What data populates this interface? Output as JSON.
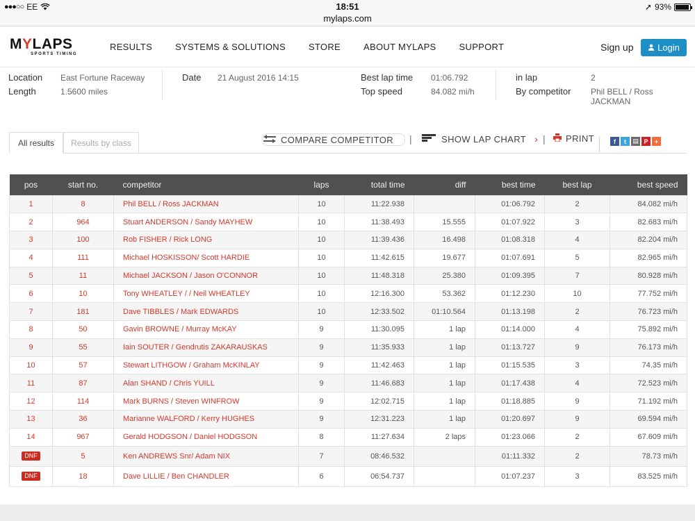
{
  "statusbar": {
    "carrier": "EE",
    "time": "18:51",
    "url": "mylaps.com",
    "battery": "93%"
  },
  "nav": {
    "logo_main_a": "M",
    "logo_main_b": "Y",
    "logo_main_c": "LAPS",
    "logo_sub": "SPORTS TIMING",
    "links": [
      "RESULTS",
      "SYSTEMS & SOLUTIONS",
      "STORE",
      "ABOUT MYLAPS",
      "SUPPORT"
    ],
    "signup": "Sign up",
    "login": "Login"
  },
  "info": {
    "location_label": "Location",
    "location_value": "East Fortune Raceway",
    "length_label": "Length",
    "length_value": "1.5600 miles",
    "date_label": "Date",
    "date_value": "21 August 2016 14:15",
    "bestlap_label": "Best lap time",
    "bestlap_value": "01:06.792",
    "topspeed_label": "Top speed",
    "topspeed_value": "84.082 mi/h",
    "inlap_label": "in lap",
    "inlap_value": "2",
    "bycomp_label": "By competitor",
    "bycomp_value": "Phil BELL / Ross JACKMAN"
  },
  "tabs": {
    "all": "All results",
    "byclass": "Results by class"
  },
  "toolbar": {
    "compare": "COMPARE COMPETITOR",
    "lapchart": "SHOW LAP CHART",
    "print": "PRINT",
    "sep": "|"
  },
  "table": {
    "headers": [
      "pos",
      "start no.",
      "competitor",
      "laps",
      "total time",
      "diff",
      "best time",
      "best lap",
      "best speed"
    ],
    "rows": [
      {
        "pos": "1",
        "start": "8",
        "competitor": "Phil BELL / Ross JACKMAN",
        "laps": "10",
        "total": "11:22.938",
        "diff": "",
        "best_time": "01:06.792",
        "best_lap": "2",
        "best_speed": "84.082 mi/h"
      },
      {
        "pos": "2",
        "start": "964",
        "competitor": "Stuart ANDERSON / Sandy MAYHEW",
        "laps": "10",
        "total": "11:38.493",
        "diff": "15.555",
        "best_time": "01:07.922",
        "best_lap": "3",
        "best_speed": "82.683 mi/h"
      },
      {
        "pos": "3",
        "start": "100",
        "competitor": "Rob FISHER / Rick LONG",
        "laps": "10",
        "total": "11:39.436",
        "diff": "16.498",
        "best_time": "01:08.318",
        "best_lap": "4",
        "best_speed": "82.204 mi/h"
      },
      {
        "pos": "4",
        "start": "111",
        "competitor": "Michael HOSKISSON/ Scott HARDIE",
        "laps": "10",
        "total": "11:42.615",
        "diff": "19.677",
        "best_time": "01:07.691",
        "best_lap": "5",
        "best_speed": "82.965 mi/h"
      },
      {
        "pos": "5",
        "start": "11",
        "competitor": "Michael JACKSON / Jason O'CONNOR",
        "laps": "10",
        "total": "11:48.318",
        "diff": "25.380",
        "best_time": "01:09.395",
        "best_lap": "7",
        "best_speed": "80.928 mi/h"
      },
      {
        "pos": "6",
        "start": "10",
        "competitor": "Tony WHEATLEY / / Neil WHEATLEY",
        "laps": "10",
        "total": "12:16.300",
        "diff": "53.362",
        "best_time": "01:12.230",
        "best_lap": "10",
        "best_speed": "77.752 mi/h"
      },
      {
        "pos": "7",
        "start": "181",
        "competitor": "Dave TIBBLES / Mark EDWARDS",
        "laps": "10",
        "total": "12:33.502",
        "diff": "01:10.564",
        "best_time": "01:13.198",
        "best_lap": "2",
        "best_speed": "76.723 mi/h"
      },
      {
        "pos": "8",
        "start": "50",
        "competitor": "Gavin BROWNE / Murray McKAY",
        "laps": "9",
        "total": "11:30.095",
        "diff": "1 lap",
        "best_time": "01:14.000",
        "best_lap": "4",
        "best_speed": "75.892 mi/h"
      },
      {
        "pos": "9",
        "start": "55",
        "competitor": "Iain SOUTER / Gendrutis ZAKARAUSKAS",
        "laps": "9",
        "total": "11:35.933",
        "diff": "1 lap",
        "best_time": "01:13.727",
        "best_lap": "9",
        "best_speed": "76.173 mi/h"
      },
      {
        "pos": "10",
        "start": "57",
        "competitor": "Stewart LITHGOW / Graham McKINLAY",
        "laps": "9",
        "total": "11:42.463",
        "diff": "1 lap",
        "best_time": "01:15.535",
        "best_lap": "3",
        "best_speed": "74.35 mi/h"
      },
      {
        "pos": "11",
        "start": "87",
        "competitor": "Alan SHAND / Chris YUILL",
        "laps": "9",
        "total": "11:46.683",
        "diff": "1 lap",
        "best_time": "01:17.438",
        "best_lap": "4",
        "best_speed": "72.523 mi/h"
      },
      {
        "pos": "12",
        "start": "114",
        "competitor": "Mark BURNS / Steven WINFROW",
        "laps": "9",
        "total": "12:02.715",
        "diff": "1 lap",
        "best_time": "01:18.885",
        "best_lap": "9",
        "best_speed": "71.192 mi/h"
      },
      {
        "pos": "13",
        "start": "36",
        "competitor": "Marianne WALFORD / Kerry HUGHES",
        "laps": "9",
        "total": "12:31.223",
        "diff": "1 lap",
        "best_time": "01:20.697",
        "best_lap": "9",
        "best_speed": "69.594 mi/h"
      },
      {
        "pos": "14",
        "start": "967",
        "competitor": "Gerald HODGSON / Daniel HODGSON",
        "laps": "8",
        "total": "11:27.634",
        "diff": "2 laps",
        "best_time": "01:23.066",
        "best_lap": "2",
        "best_speed": "67.609 mi/h"
      },
      {
        "pos": "DNF",
        "start": "5",
        "competitor": "Ken ANDREWS Snr/ Adam NIX",
        "laps": "7",
        "total": "08:46.532",
        "diff": "",
        "best_time": "01:11.332",
        "best_lap": "2",
        "best_speed": "78.73 mi/h"
      },
      {
        "pos": "DNF",
        "start": "18",
        "competitor": "Dave LILLIE / Ben CHANDLER",
        "laps": "6",
        "total": "06:54.737",
        "diff": "",
        "best_time": "01:07.237",
        "best_lap": "3",
        "best_speed": "83.525 mi/h"
      }
    ]
  },
  "share": [
    "f",
    "t",
    "▤",
    "P",
    "+"
  ],
  "colors": {
    "accent_red": "#d2382a",
    "login_blue": "#1e8fc6",
    "header_gray": "#505050"
  }
}
